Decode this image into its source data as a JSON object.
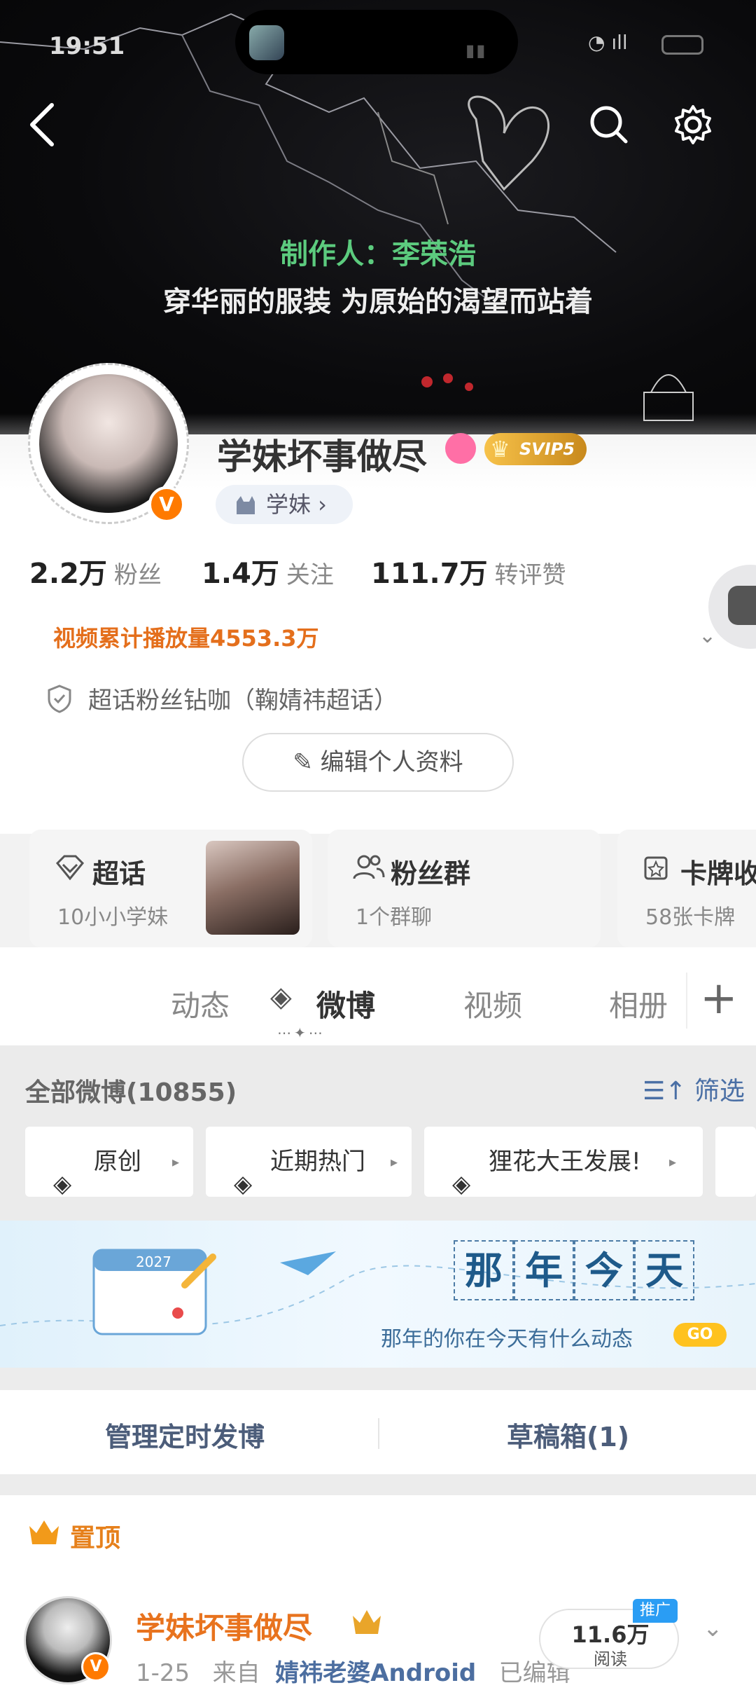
{
  "status_bar": {
    "time": "19:51"
  },
  "banner": {
    "producer": "制作人：李荣浩",
    "tagline": "穿华丽的服装 为原始的渴望而站着"
  },
  "profile": {
    "username": "学妹坏事做尽",
    "svip_label": "SVIP5",
    "tag_label": "学妹 ›",
    "stats": [
      {
        "value": "2.2万",
        "label": "粉丝"
      },
      {
        "value": "1.4万",
        "label": "关注"
      },
      {
        "value": "111.7万",
        "label": "转评赞"
      }
    ],
    "video_plays": "视频累计播放量4553.3万",
    "superfan": "超话粉丝钻咖（鞠婧祎超话）",
    "edit_label": "编辑个人资料",
    "verified_badge": "V"
  },
  "cards": [
    {
      "title": "超话",
      "sub": "10小小学妹"
    },
    {
      "title": "粉丝群",
      "sub": "1个群聊"
    },
    {
      "title": "卡牌收",
      "sub": "58张卡牌"
    }
  ],
  "tabs": [
    {
      "label": "动态"
    },
    {
      "label": "微博"
    },
    {
      "label": "视频"
    },
    {
      "label": "相册"
    }
  ],
  "feed": {
    "all_label": "全部微博(10855)",
    "filter_label": "筛选",
    "chips": [
      {
        "label": "原创"
      },
      {
        "label": "近期热门"
      },
      {
        "label": "狸花大王发展!"
      }
    ]
  },
  "memory": {
    "chars": [
      "那",
      "年",
      "今",
      "天"
    ],
    "subtitle": "那年的你在今天有什么动态",
    "go": "GO",
    "calendar_year": "2027"
  },
  "manage": {
    "scheduled": "管理定时发博",
    "drafts": "草稿箱(1)"
  },
  "post": {
    "pinned": "置顶",
    "name": "学妹坏事做尽",
    "date": "1-25",
    "from_label": "来自",
    "source": "婧祎老婆Android",
    "edited": "已编辑",
    "reads_num": "11.6万",
    "reads_label": "阅读",
    "promo": "推广",
    "verified_badge": "V"
  },
  "colors": {
    "accent_orange": "#e8731e",
    "link_blue": "#4c6ea0",
    "producer_green": "#5ccb7e"
  }
}
